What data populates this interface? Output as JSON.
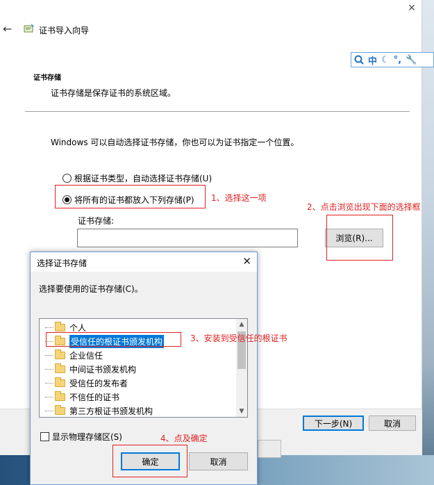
{
  "wizard": {
    "title": "证书导入向导",
    "section_title": "证书存储",
    "section_desc": "证书存储是保存证书的系统区域。",
    "intro": "Windows 可以自动选择证书存储，你也可以为证书指定一个位置。",
    "radio_auto": "根据证书类型，自动选择证书存储(U)",
    "radio_manual": "将所有的证书都放入下列存储(P)",
    "store_label": "证书存储:",
    "store_value": "",
    "browse_label": "浏览(R)...",
    "next_label": "下一步(N)",
    "cancel_label": "取消"
  },
  "ime": {
    "lang": "中"
  },
  "annotations": {
    "step1": "1、选择这一项",
    "step2": "2、点击浏览出现下面的选择框",
    "step3": "3、安装到受信任的根证书",
    "step4": "4、点及确定",
    "color": "#e02020"
  },
  "dialog": {
    "title": "选择证书存储",
    "desc": "选择要使用的证书存储(C)。",
    "items": [
      {
        "label": "个人",
        "selected": false
      },
      {
        "label": "受信任的根证书颁发机构",
        "selected": true
      },
      {
        "label": "企业信任",
        "selected": false
      },
      {
        "label": "中间证书颁发机构",
        "selected": false
      },
      {
        "label": "受信任的发布者",
        "selected": false
      },
      {
        "label": "不信任的证书",
        "selected": false
      },
      {
        "label": "第三方根证书颁发机构",
        "selected": false
      }
    ],
    "show_physical": "显示物理存储区(S)",
    "ok_label": "确定",
    "cancel_label": "取消"
  },
  "colors": {
    "accent": "#0078d7",
    "annotation": "#e02020"
  }
}
